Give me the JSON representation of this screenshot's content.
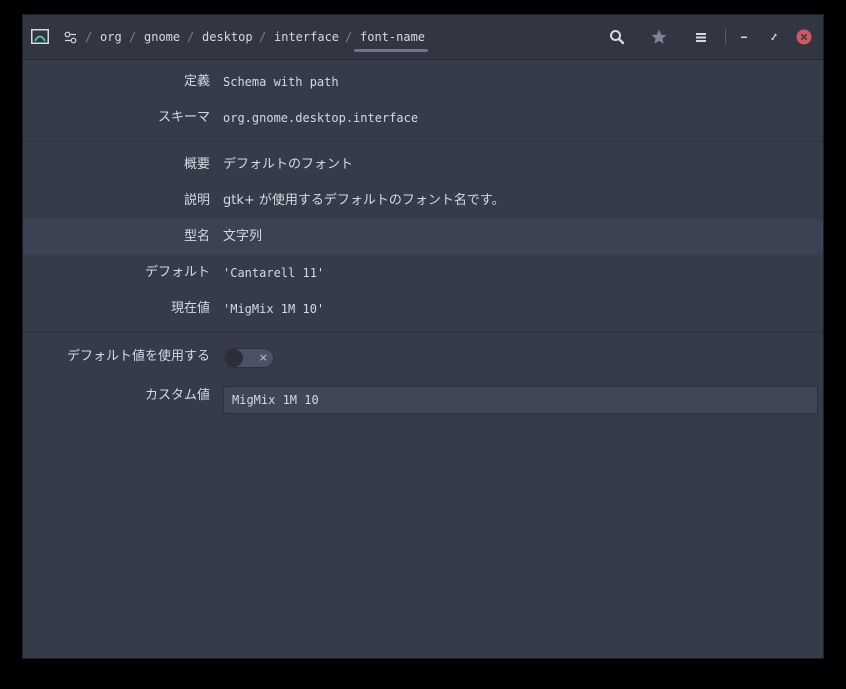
{
  "header": {
    "breadcrumbs": [
      "org",
      "gnome",
      "desktop",
      "interface",
      "font-name"
    ],
    "separator": "/",
    "icons": {
      "app": "dconf-editor-icon",
      "prefs": "settings-toggles-icon",
      "search": "search-icon",
      "bookmark": "star-icon",
      "menu": "hamburger-menu-icon",
      "minimize": "minimize-icon",
      "restore": "restore-icon",
      "close": "close-icon"
    },
    "colors": {
      "close_button": "#d0595f",
      "app_icon": "#4fc3a1"
    }
  },
  "properties": {
    "definition": {
      "label": "定義",
      "value": "Schema with path"
    },
    "schema": {
      "label": "スキーマ",
      "value": "org.gnome.desktop.interface"
    },
    "summary": {
      "label": "概要",
      "value": "デフォルトのフォント"
    },
    "description": {
      "label": "説明",
      "value": "gtk+ が使用するデフォルトのフォント名です。"
    },
    "type": {
      "label": "型名",
      "value": "文字列"
    },
    "default": {
      "label": "デフォルト",
      "value": "'Cantarell 11'"
    },
    "current": {
      "label": "現在値",
      "value": "'MigMix 1M 10'"
    }
  },
  "use_default": {
    "label": "デフォルト値を使用する",
    "enabled": false,
    "off_glyph": "×"
  },
  "custom_value": {
    "label": "カスタム値",
    "value": "MigMix 1M 10"
  }
}
